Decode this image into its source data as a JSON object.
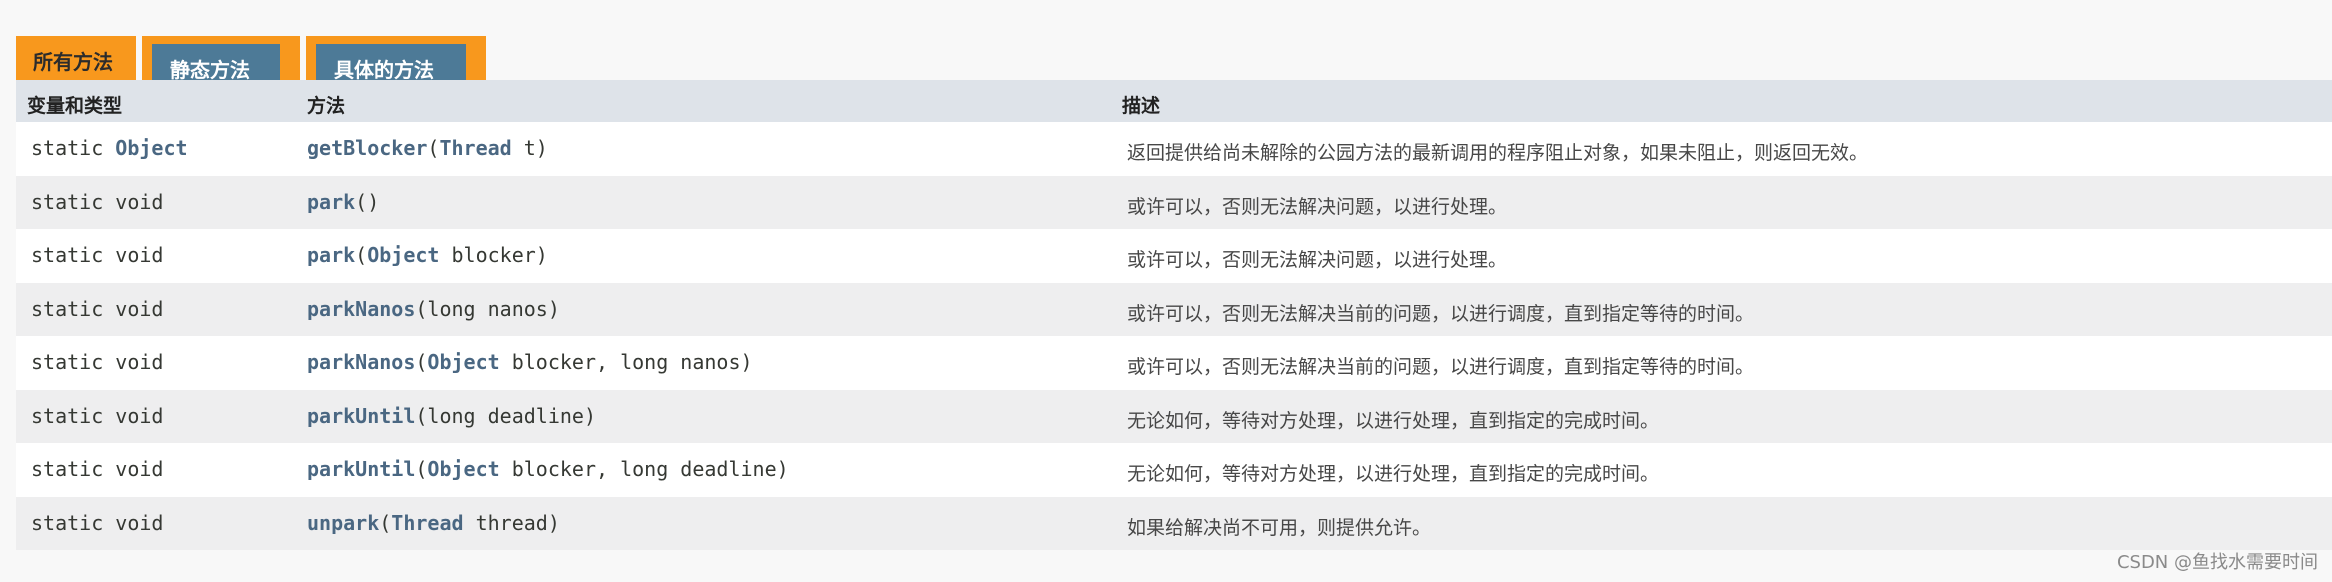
{
  "tabs": [
    {
      "label": "所有方法",
      "active": true
    },
    {
      "label": "静态方法",
      "active": false
    },
    {
      "label": "具体的方法",
      "active": false
    }
  ],
  "table": {
    "headers": [
      "变量和类型",
      "方法",
      "描述"
    ],
    "rows": [
      {
        "modifier": "static ",
        "type": "Object",
        "method": "getBlocker",
        "params": [
          {
            "text": "(",
            "link": false
          },
          {
            "text": "Thread",
            "link": true
          },
          {
            "text": " t)",
            "link": false
          }
        ],
        "desc": "返回提供给尚未解除的公园方法的最新调用的程序阻止对象，如果未阻止，则返回无效。"
      },
      {
        "modifier": "static void",
        "type": "",
        "method": "park",
        "params": [
          {
            "text": "()",
            "link": false
          }
        ],
        "desc": "或许可以，否则无法解决问题，以进行处理。"
      },
      {
        "modifier": "static void",
        "type": "",
        "method": "park",
        "params": [
          {
            "text": "(",
            "link": false
          },
          {
            "text": "Object",
            "link": true
          },
          {
            "text": " blocker)",
            "link": false
          }
        ],
        "desc": "或许可以，否则无法解决问题，以进行处理。"
      },
      {
        "modifier": "static void",
        "type": "",
        "method": "parkNanos",
        "params": [
          {
            "text": "(long nanos)",
            "link": false
          }
        ],
        "desc": "或许可以，否则无法解决当前的问题，以进行调度，直到指定等待的时间。"
      },
      {
        "modifier": "static void",
        "type": "",
        "method": "parkNanos",
        "params": [
          {
            "text": "(",
            "link": false
          },
          {
            "text": "Object",
            "link": true
          },
          {
            "text": " blocker, long nanos)",
            "link": false
          }
        ],
        "desc": "或许可以，否则无法解决当前的问题，以进行调度，直到指定等待的时间。"
      },
      {
        "modifier": "static void",
        "type": "",
        "method": "parkUntil",
        "params": [
          {
            "text": "(long deadline)",
            "link": false
          }
        ],
        "desc": "无论如何，等待对方处理，以进行处理，直到指定的完成时间。"
      },
      {
        "modifier": "static void",
        "type": "",
        "method": "parkUntil",
        "params": [
          {
            "text": "(",
            "link": false
          },
          {
            "text": "Object",
            "link": true
          },
          {
            "text": " blocker, long deadline)",
            "link": false
          }
        ],
        "desc": "无论如何，等待对方处理，以进行处理，直到指定的完成时间。"
      },
      {
        "modifier": "static void",
        "type": "",
        "method": "unpark",
        "params": [
          {
            "text": "(",
            "link": false
          },
          {
            "text": "Thread",
            "link": true
          },
          {
            "text": " thread)",
            "link": false
          }
        ],
        "desc": "如果给解决尚不可用，则提供允许。"
      }
    ]
  },
  "watermark": "CSDN @鱼找水需要时间",
  "colors": {
    "tab_orange": "#f8981d",
    "tab_blue": "#4d7a97",
    "header_bg": "#dee3e9",
    "link": "#4a6782"
  }
}
